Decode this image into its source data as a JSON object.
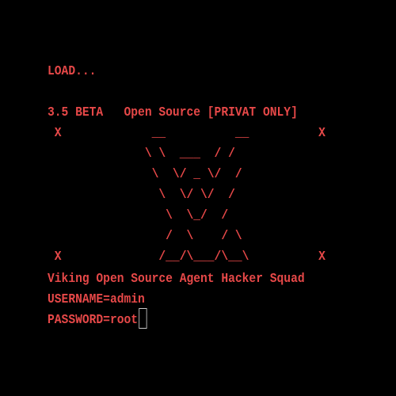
{
  "terminal": {
    "load_line": "LOAD...",
    "version_line": "3.5 BETA   Open Source [PRIVAT ONLY]",
    "art": [
      " X             __          __          X",
      "              \\ \\  ___  / /",
      "               \\  \\/ _ \\/  /",
      "                \\  \\/ \\/  /",
      "                 \\  \\_/  /",
      "                 /  \\    / \\",
      " X              /__/\\___/\\__\\          X"
    ],
    "banner_line": "Viking Open Source Agent Hacker Squad",
    "username_line": "USERNAME=admin",
    "password_line": "PASSWORD=root"
  },
  "colors": {
    "text": "#e64848",
    "background": "#000000",
    "cursor_border": "#c8c8c8"
  }
}
